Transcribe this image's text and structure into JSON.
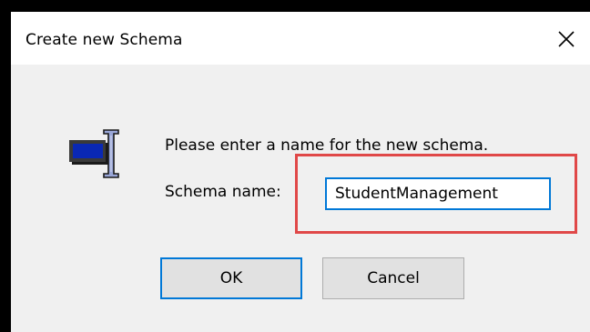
{
  "dialog": {
    "title": "Create new Schema",
    "close_icon": "close-icon",
    "app_icon": "input-field-icon",
    "prompt": "Please enter a name for the new schema.",
    "field_label": "Schema name:",
    "field_value": "StudentManagement",
    "ok_label": "OK",
    "cancel_label": "Cancel"
  },
  "colors": {
    "focus_border": "#0078d7",
    "highlight_annotation": "#e04848",
    "dialog_background": "#f0f0f0",
    "title_background": "#ffffff"
  }
}
